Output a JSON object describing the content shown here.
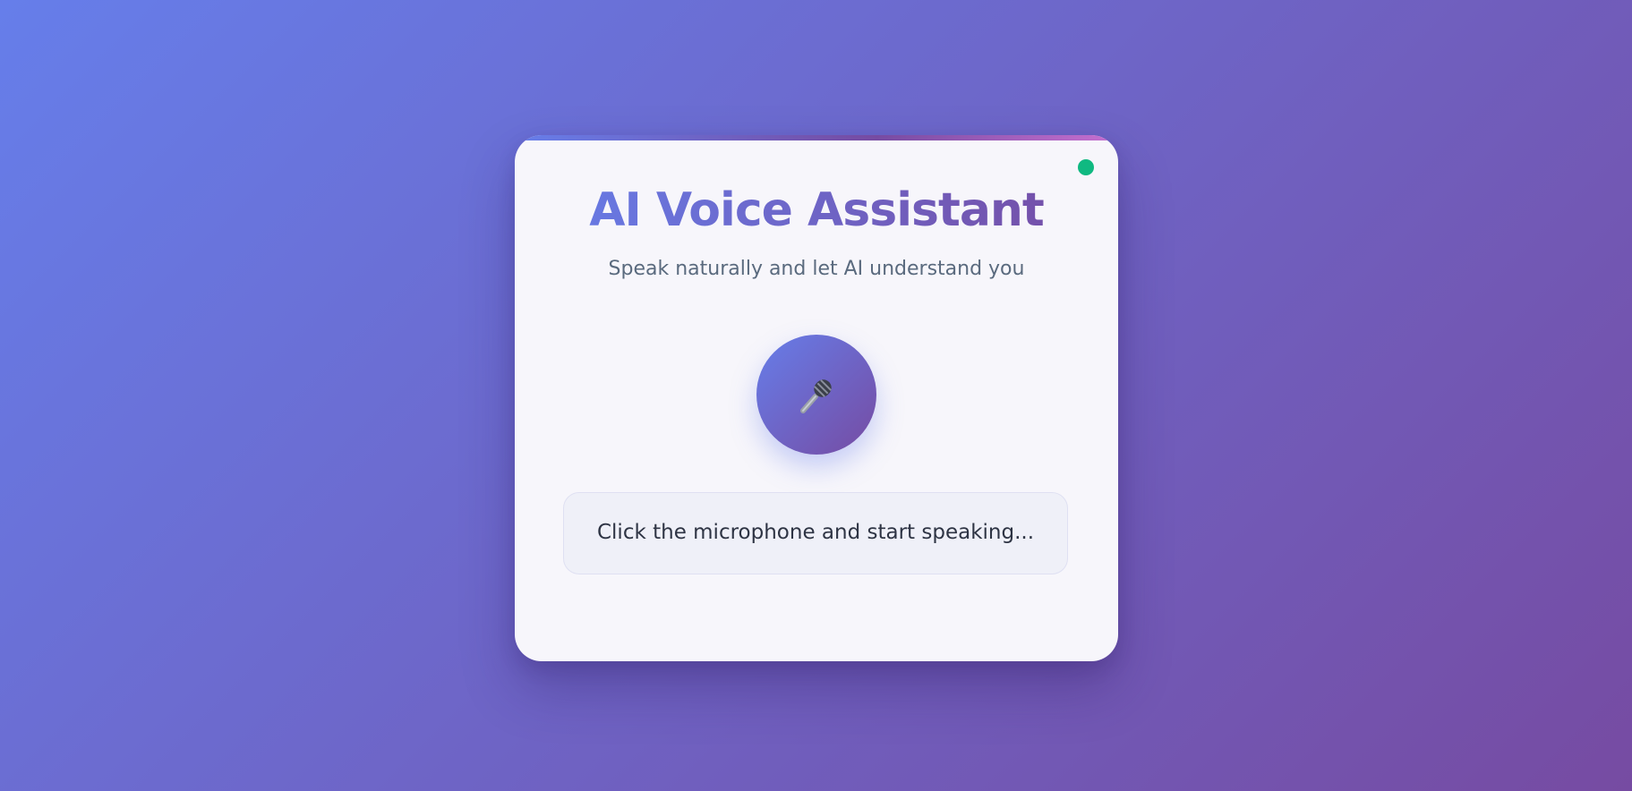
{
  "app": {
    "title": "AI Voice Assistant",
    "subtitle": "Speak naturally and let AI understand you"
  },
  "status": {
    "indicator_icon": "online-status-dot",
    "color": "#10b981"
  },
  "mic": {
    "icon": "microphone-icon"
  },
  "transcript": {
    "text": "Click the microphone and start speaking..."
  },
  "theme": {
    "gradient_start": "#667eea",
    "gradient_end": "#764ba2"
  }
}
